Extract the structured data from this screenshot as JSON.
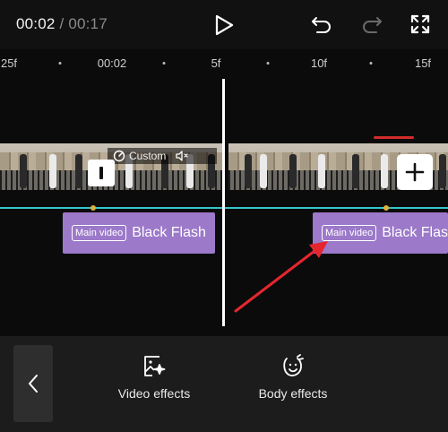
{
  "header": {
    "current_time": "00:02",
    "separator": " / ",
    "total_duration": "00:17"
  },
  "icons": {
    "play": "play-icon",
    "undo": "undo-icon",
    "redo": "redo-icon",
    "fullscreen": "fullscreen-icon",
    "back": "chevron-left-icon",
    "video_effects": "video-effects-icon",
    "body_effects": "body-effects-icon",
    "speed": "speed-icon",
    "mute": "mute-icon",
    "transition": "transition-icon",
    "add": "add-icon"
  },
  "ruler": {
    "labels": [
      "25f",
      "00:02",
      "5f",
      "10f",
      "15f"
    ]
  },
  "clip": {
    "speed_label": "Custom"
  },
  "effects": [
    {
      "badge": "Main video",
      "name": "Black Flash"
    },
    {
      "badge": "Main video",
      "name": "Black Flash"
    }
  ],
  "toolbar": {
    "video_effects_label": "Video effects",
    "body_effects_label": "Body effects"
  },
  "colors": {
    "accent_cyan": "#34c6c9",
    "effect_purple": "#9c79c9",
    "keyframe_yellow": "#e0b03a",
    "annotation_red": "#e5262e"
  }
}
